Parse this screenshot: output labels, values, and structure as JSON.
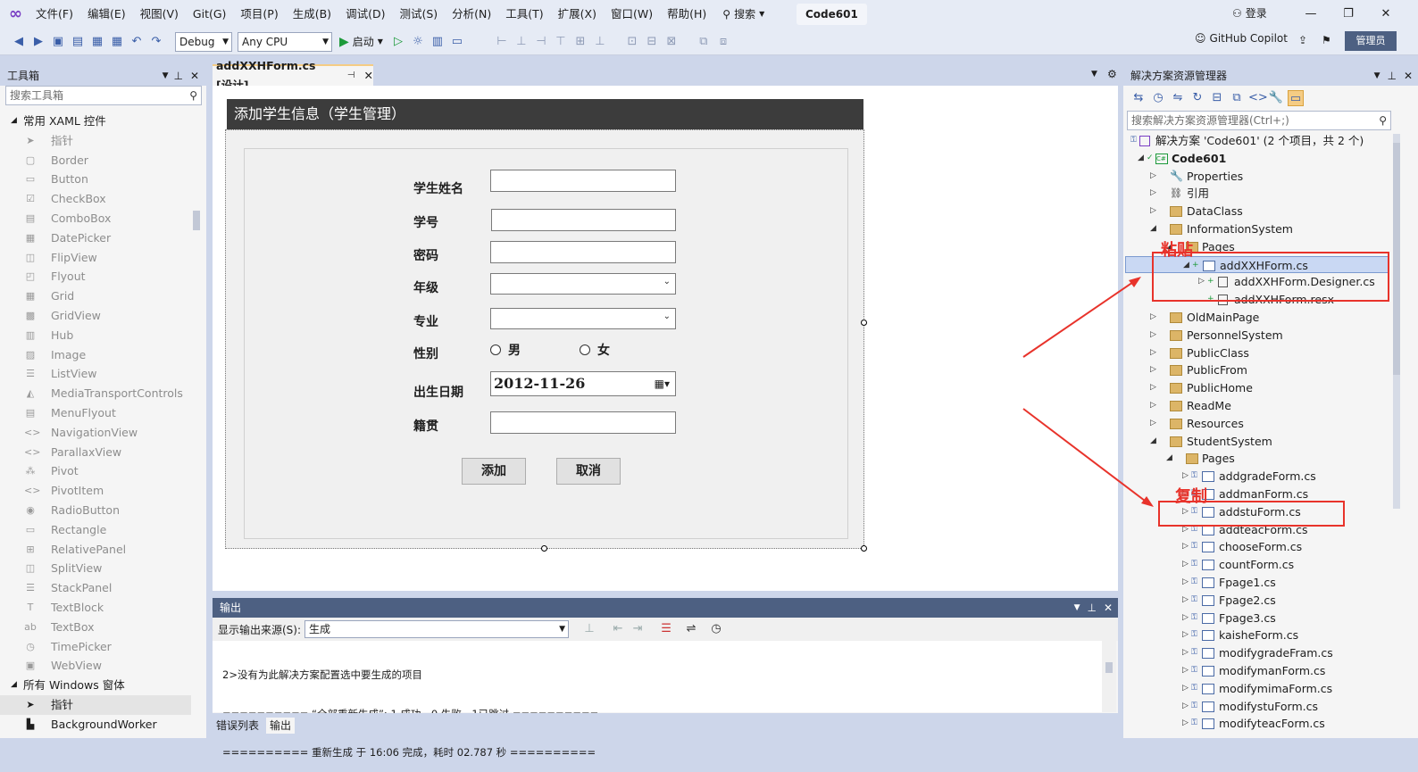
{
  "menu": {
    "items": [
      "文件(F)",
      "编辑(E)",
      "视图(V)",
      "Git(G)",
      "项目(P)",
      "生成(B)",
      "调试(D)",
      "测试(S)",
      "分析(N)",
      "工具(T)",
      "扩展(X)",
      "窗口(W)",
      "帮助(H)"
    ],
    "search": "搜索",
    "project_title": "Code601",
    "login": "登录"
  },
  "toolbar": {
    "config": "Debug",
    "platform": "Any CPU",
    "start": "启动",
    "copilot": "GitHub Copilot",
    "admin": "管理员"
  },
  "toolbox": {
    "title": "工具箱",
    "search_placeholder": "搜索工具箱",
    "group1": "常用 XAML 控件",
    "items": [
      "指针",
      "Border",
      "Button",
      "CheckBox",
      "ComboBox",
      "DatePicker",
      "FlipView",
      "Flyout",
      "Grid",
      "GridView",
      "Hub",
      "Image",
      "ListView",
      "MediaTransportControls",
      "MenuFlyout",
      "NavigationView",
      "ParallaxView",
      "Pivot",
      "PivotItem",
      "RadioButton",
      "Rectangle",
      "RelativePanel",
      "SplitView",
      "StackPanel",
      "TextBlock",
      "TextBox",
      "TimePicker",
      "WebView"
    ],
    "group2": "所有 Windows 窗体",
    "group2_items": [
      "指针",
      "BackgroundWorker"
    ]
  },
  "doc_tab": {
    "label": "addXXHForm.cs [设计]"
  },
  "form": {
    "title": "添加学生信息（学生管理）",
    "labels": {
      "name": "学生姓名",
      "id": "学号",
      "password": "密码",
      "grade": "年级",
      "major": "专业",
      "gender": "性别",
      "birth": "出生日期",
      "origin": "籍贯"
    },
    "gender_male": "男",
    "gender_female": "女",
    "birth_value": "2012-11-26",
    "add_button": "添加",
    "cancel_button": "取消"
  },
  "output": {
    "title": "输出",
    "source_label": "显示输出来源(S):",
    "source_value": "生成",
    "lines": [
      "2>没有为此解决方案配置选中要生成的项目",
      "========== “全部重新生成”: 1 成功，0 失败，1已跳过 ==========",
      "========== 重新生成 于 16:06 完成，耗时 02.787 秒 =========="
    ],
    "tab_errors": "错误列表",
    "tab_output": "输出"
  },
  "solution": {
    "title": "解决方案资源管理器",
    "search_placeholder": "搜索解决方案资源管理器(Ctrl+;)",
    "root": "解决方案 'Code601' (2 个项目，共 2 个)",
    "project": "Code601",
    "nodes": [
      "Properties",
      "引用",
      "DataClass",
      "InformationSystem",
      "Pages",
      "addXXHForm.cs",
      "addXXHForm.Designer.cs",
      "addXXHForm.resx",
      "OldMainPage",
      "PersonnelSystem",
      "PublicClass",
      "PublicFrom",
      "PublicHome",
      "ReadMe",
      "Resources",
      "StudentSystem",
      "Pages",
      "addgradeForm.cs",
      "addmanForm.cs",
      "addstuForm.cs",
      "addteacForm.cs",
      "chooseForm.cs",
      "countForm.cs",
      "Fpage1.cs",
      "Fpage2.cs",
      "Fpage3.cs",
      "kaisheForm.cs",
      "modifygradeFram.cs",
      "modifymanForm.cs",
      "modifymimaForm.cs",
      "modifystuForm.cs",
      "modifyteacForm.cs"
    ]
  },
  "annotations": {
    "paste": "粘贴",
    "copy": "复制"
  },
  "colors": {
    "accent": "#4d6082",
    "annotation_red": "#e8332b",
    "form_title_bg": "#3c3c3c"
  }
}
